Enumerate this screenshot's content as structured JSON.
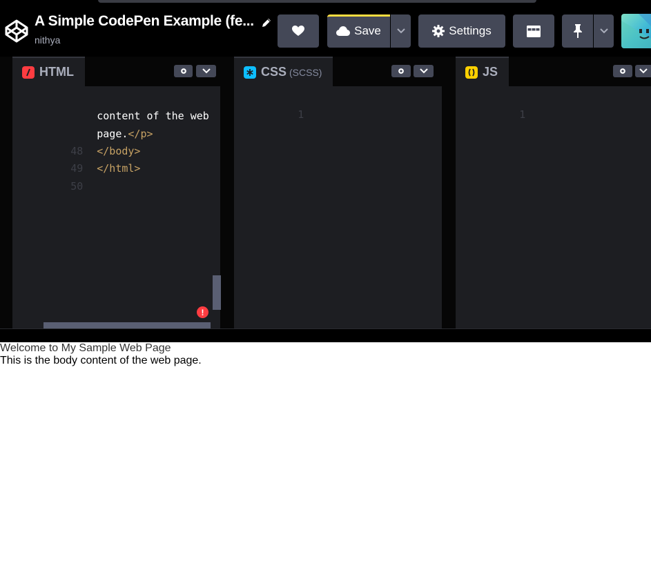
{
  "header": {
    "title": "A Simple CodePen Example (fe...",
    "author": "nithya",
    "save_label": "Save",
    "settings_label": "Settings",
    "save_accent": "#ffdd40",
    "icons": {
      "logo": "codepen-logo-icon",
      "edit": "pencil-icon",
      "like": "heart-icon",
      "save": "cloud-icon",
      "settings": "gear-icon",
      "layout": "layout-icon",
      "pin": "pin-icon",
      "dropdown": "chevron-down-icon"
    }
  },
  "editors": {
    "html": {
      "name": "HTML",
      "icon_color": "#ff3c41",
      "lines": [
        {
          "num": "",
          "text": "content of the web",
          "tag": ""
        },
        {
          "num": "",
          "text": "page.",
          "tag": "</p>"
        },
        {
          "num": "48",
          "text": "",
          "tag": "</body>"
        },
        {
          "num": "49",
          "text": "",
          "tag": "</html>"
        },
        {
          "num": "50",
          "text": "",
          "tag": ""
        }
      ],
      "error_badge": "!"
    },
    "css": {
      "name": "CSS",
      "sub": "(SCSS)",
      "icon_color": "#0ebeff",
      "line_num": "1"
    },
    "js": {
      "name": "JS",
      "icon_color": "#fcd000",
      "line_num": "1"
    }
  },
  "preview": {
    "heading": "Welcome to My Sample Web Page",
    "paragraph": "This is the body content of the web page."
  }
}
